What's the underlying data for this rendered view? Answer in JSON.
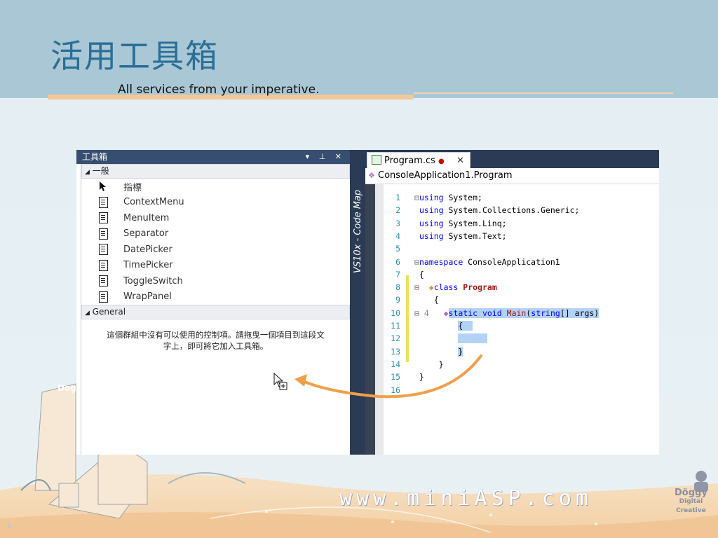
{
  "slide": {
    "title": "活用工具箱",
    "subtitle": "All services from your imperative.",
    "watermark": "www.miniASP.com",
    "logo": "Doggy Digital Creative",
    "page_number": "6"
  },
  "toolbox": {
    "title": "工具箱",
    "controls": "▾ ⊥ ✕",
    "group_general_cn": "一般",
    "items": [
      {
        "label": "指標",
        "icon": "pointer-icon"
      },
      {
        "label": "ContextMenu",
        "icon": "control-icon"
      },
      {
        "label": "MenuItem",
        "icon": "control-icon"
      },
      {
        "label": "Separator",
        "icon": "control-icon"
      },
      {
        "label": "DatePicker",
        "icon": "control-icon"
      },
      {
        "label": "TimePicker",
        "icon": "control-icon"
      },
      {
        "label": "ToggleSwitch",
        "icon": "control-icon"
      },
      {
        "label": "WrapPanel",
        "icon": "control-icon"
      }
    ],
    "group_general_en": "General",
    "empty_message_line1": "這個群組中沒有可以使用的控制項。請拖曳一個項目到這段文",
    "empty_message_line2": "字上，即可將它加入工具箱。"
  },
  "code_map_label": "VS10x - Code Map",
  "editor": {
    "tab_label": "Program.cs",
    "tab_modified": "●",
    "tab_close": "✕",
    "breadcrumb": "ConsoleApplication1.Program",
    "lines": [
      {
        "n": "1",
        "t": "using System;"
      },
      {
        "n": "2",
        "t": "using System.Collections.Generic;"
      },
      {
        "n": "3",
        "t": "using System.Linq;"
      },
      {
        "n": "4",
        "t": "using System.Text;"
      },
      {
        "n": "5",
        "t": ""
      },
      {
        "n": "6",
        "t": "namespace ConsoleApplication1"
      },
      {
        "n": "7",
        "t": "{"
      },
      {
        "n": "8",
        "t": "class Program"
      },
      {
        "n": "9",
        "t": "{"
      },
      {
        "n": "10",
        "t": "static void Main(string[] args)"
      },
      {
        "n": "11",
        "t": "{"
      },
      {
        "n": "12",
        "t": ""
      },
      {
        "n": "13",
        "t": "}"
      },
      {
        "n": "14",
        "t": "}"
      },
      {
        "n": "15",
        "t": "}"
      },
      {
        "n": "16",
        "t": ""
      }
    ],
    "ref_count": "4"
  },
  "colors": {
    "accent_orange": "#f0a04a",
    "keyword": "#0000ff",
    "type": "#a31515",
    "selection": "#b2d2f6",
    "title_blue": "#2a6f97"
  }
}
